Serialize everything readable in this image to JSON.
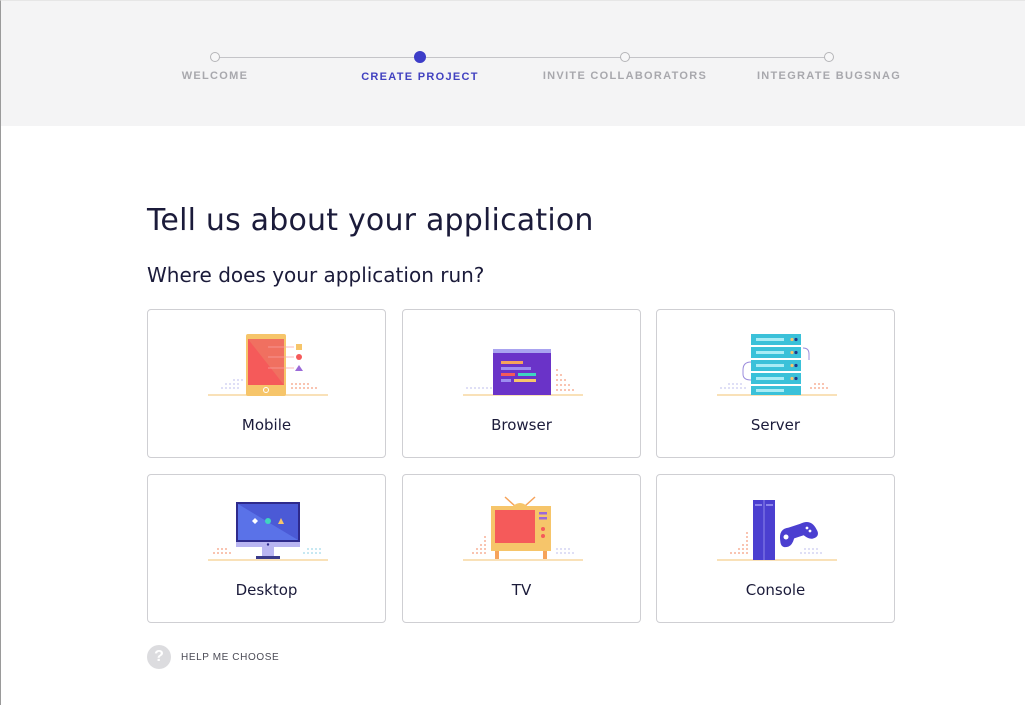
{
  "stepper": {
    "steps": [
      {
        "label": "WELCOME",
        "active": false
      },
      {
        "label": "CREATE PROJECT",
        "active": true
      },
      {
        "label": "INVITE COLLABORATORS",
        "active": false
      },
      {
        "label": "INTEGRATE BUGSNAG",
        "active": false
      }
    ]
  },
  "main": {
    "title": "Tell us about your application",
    "subtitle": "Where does your application run?",
    "options": [
      {
        "label": "Mobile",
        "icon": "mobile-icon"
      },
      {
        "label": "Browser",
        "icon": "browser-icon"
      },
      {
        "label": "Server",
        "icon": "server-icon"
      },
      {
        "label": "Desktop",
        "icon": "desktop-icon"
      },
      {
        "label": "TV",
        "icon": "tv-icon"
      },
      {
        "label": "Console",
        "icon": "console-icon"
      }
    ],
    "help_label": "HELP ME CHOOSE",
    "help_icon": "question-icon"
  },
  "colors": {
    "accent": "#3d3dc8",
    "title": "#1b1b3a",
    "stepper_bg": "#f4f4f5",
    "card_border": "#cfcfd3"
  }
}
